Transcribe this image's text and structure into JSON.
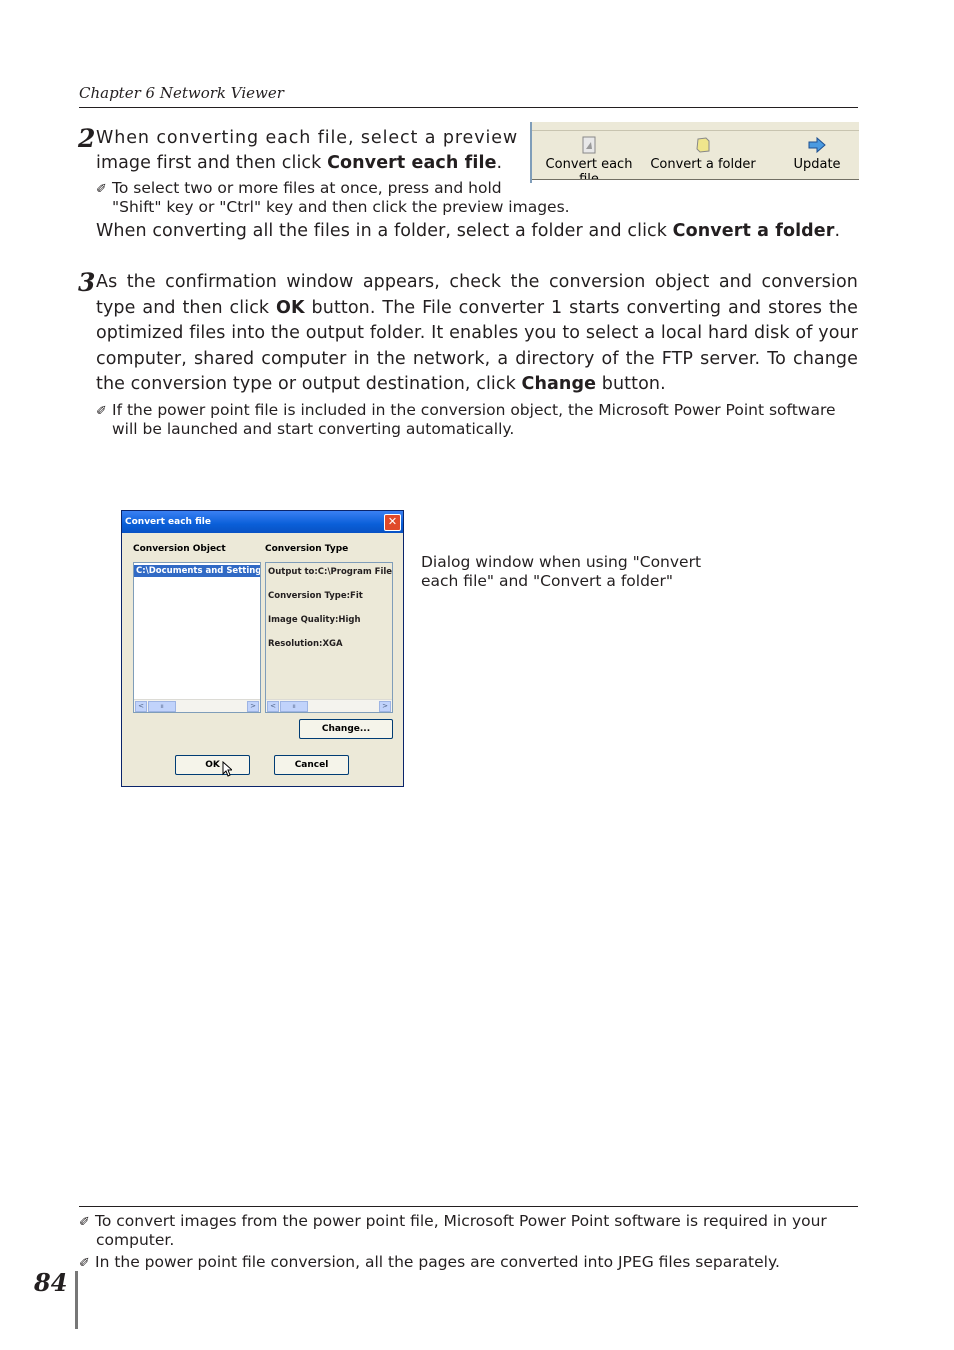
{
  "header": {
    "chapter": "Chapter 6 Network Viewer"
  },
  "step2": {
    "number": "2",
    "line1": "When converting each file, select a preview",
    "line2_pre": "image first and then click ",
    "line2_bold": "Convert each file",
    "line2_post": ".",
    "note_line1": "To select two or more files at once, press and hold",
    "note_line2": "\"Shift\" key or \"Ctrl\" key and then click the preview images.",
    "folder_pre": "When converting all the files in a folder, select a folder and click ",
    "folder_bold": "Convert a folder",
    "folder_post": "."
  },
  "toolbar": {
    "buttons": [
      {
        "label": "Convert each file",
        "icon": "file-icon"
      },
      {
        "label": "Convert a folder",
        "icon": "folder-icon"
      },
      {
        "label": "Update",
        "icon": "arrow-right-icon"
      }
    ]
  },
  "step3": {
    "number": "3",
    "p1_pre": "As the confirmation window appears, check the conversion object and conversion type and then click ",
    "p1_ok": "OK",
    "p1_mid": " button. The File converter 1 starts converting and stores the optimized files into the output folder. It enables you to select a local hard disk of your computer, shared computer in the network, a directory of the FTP server. To change the conversion type or output destination, click ",
    "p1_change": "Change",
    "p1_post": " button.",
    "note_line1": "If the power point file is included in the conversion object, the Microsoft Power Point software",
    "note_line2": "will be launched and start converting automatically."
  },
  "dialog": {
    "title": "Convert each file",
    "close": "✕",
    "object_label": "Conversion Object",
    "type_label": "Conversion Type",
    "objects": [
      "C:\\Documents and Settings"
    ],
    "types": [
      "Output to:C:\\Program Files",
      "Conversion Type:Fit",
      "Image Quality:High",
      "Resolution:XGA"
    ],
    "change_button": "Change...",
    "ok_button": "OK",
    "cancel_button": "Cancel"
  },
  "caption": {
    "line1": "Dialog window when using \"Convert",
    "line2": "each file\" and \"Convert a folder\""
  },
  "footnotes": [
    {
      "line1": "To convert images from the power point file, Microsoft Power Point software is required in your",
      "line2": "computer."
    },
    {
      "line1": "In the power point file conversion, all the pages are converted into JPEG files separately."
    }
  ],
  "page_number": "84",
  "pencil": "✐"
}
